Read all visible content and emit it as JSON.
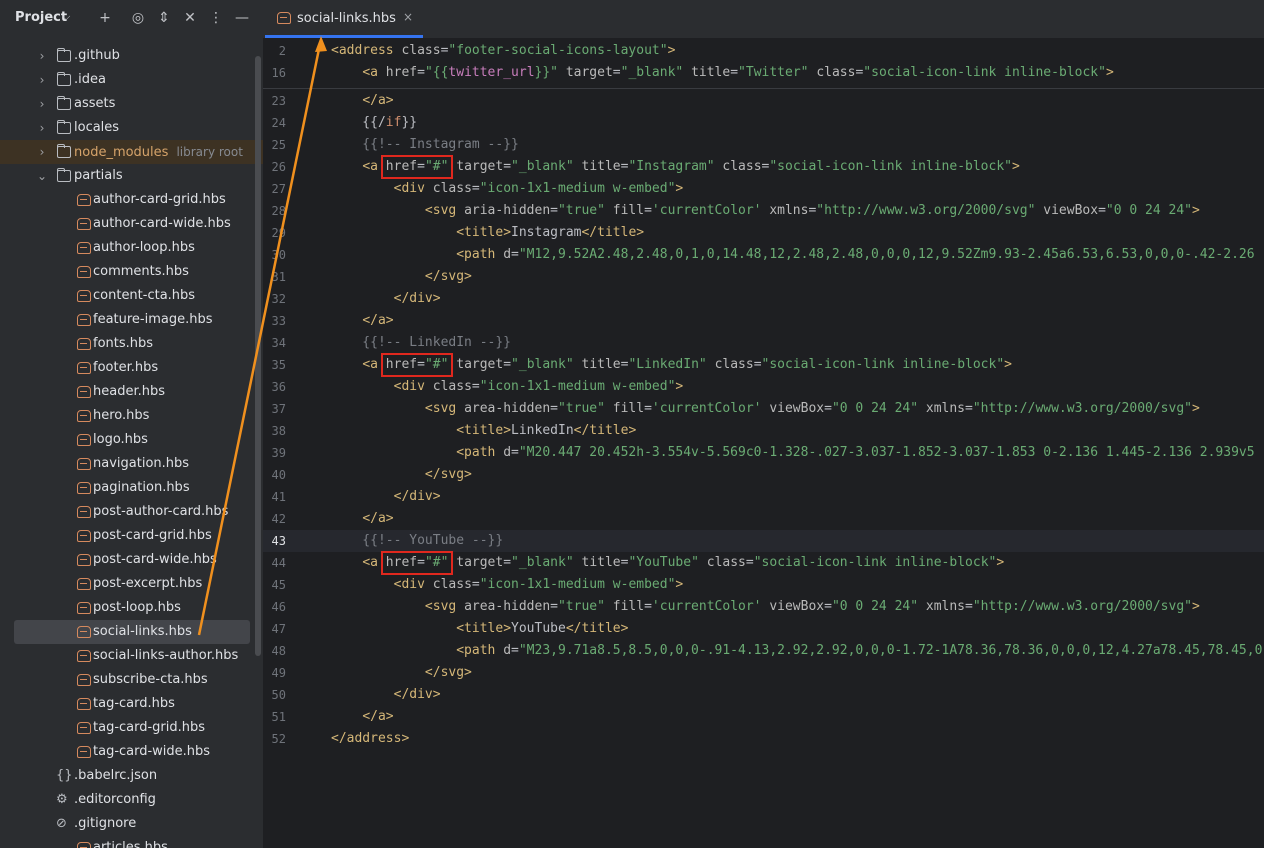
{
  "project": {
    "title": "Project"
  },
  "tree": [
    {
      "label": ".github",
      "kind": "folder"
    },
    {
      "label": ".idea",
      "kind": "folder"
    },
    {
      "label": "assets",
      "kind": "folder"
    },
    {
      "label": "locales",
      "kind": "folder"
    },
    {
      "label": "node_modules",
      "hint": "library root",
      "kind": "folder"
    },
    {
      "label": "partials",
      "kind": "folder-open"
    },
    {
      "label": "author-card-grid.hbs"
    },
    {
      "label": "author-card-wide.hbs"
    },
    {
      "label": "author-loop.hbs"
    },
    {
      "label": "comments.hbs"
    },
    {
      "label": "content-cta.hbs"
    },
    {
      "label": "feature-image.hbs"
    },
    {
      "label": "fonts.hbs"
    },
    {
      "label": "footer.hbs"
    },
    {
      "label": "header.hbs"
    },
    {
      "label": "hero.hbs"
    },
    {
      "label": "logo.hbs"
    },
    {
      "label": "navigation.hbs"
    },
    {
      "label": "pagination.hbs"
    },
    {
      "label": "post-author-card.hbs"
    },
    {
      "label": "post-card-grid.hbs"
    },
    {
      "label": "post-card-wide.hbs"
    },
    {
      "label": "post-excerpt.hbs"
    },
    {
      "label": "post-loop.hbs"
    },
    {
      "label": "social-links.hbs",
      "selected": true
    },
    {
      "label": "social-links-author.hbs"
    },
    {
      "label": "subscribe-cta.hbs"
    },
    {
      "label": "tag-card.hbs"
    },
    {
      "label": "tag-card-grid.hbs"
    },
    {
      "label": "tag-card-wide.hbs"
    },
    {
      "label": ".babelrc.json",
      "kind": "json"
    },
    {
      "label": ".editorconfig",
      "kind": "config"
    },
    {
      "label": ".gitignore",
      "kind": "ignore"
    },
    {
      "label": "articles.hbs"
    }
  ],
  "tab": {
    "label": "social-links.hbs",
    "close": "×"
  },
  "sticky": [
    {
      "num": "2",
      "code": [
        [
          "t",
          "<address "
        ],
        [
          "a",
          "class"
        ],
        [
          "p",
          "="
        ],
        [
          "v",
          "\"footer-social-icons-layout\""
        ],
        [
          "t",
          ">"
        ]
      ]
    },
    {
      "num": "16",
      "code": [
        [
          "p",
          "    "
        ],
        [
          "t",
          "<a "
        ],
        [
          "a",
          "href"
        ],
        [
          "p",
          "="
        ],
        [
          "v",
          "\"{{"
        ],
        [
          "vr",
          "twitter_url"
        ],
        [
          "v",
          "}}\" "
        ],
        [
          "a",
          "target"
        ],
        [
          "p",
          "="
        ],
        [
          "v",
          "\"_blank\" "
        ],
        [
          "a",
          "title"
        ],
        [
          "p",
          "="
        ],
        [
          "v",
          "\"Twitter\" "
        ],
        [
          "a",
          "class"
        ],
        [
          "p",
          "="
        ],
        [
          "v",
          "\"social-icon-link inline-block\""
        ],
        [
          "t",
          ">"
        ]
      ]
    }
  ],
  "lines": [
    {
      "num": "23",
      "code": [
        [
          "p",
          "    "
        ],
        [
          "t",
          "</a>"
        ]
      ]
    },
    {
      "num": "24",
      "code": [
        [
          "p",
          "    {{/"
        ],
        [
          "k",
          "if"
        ],
        [
          "p",
          "}}"
        ]
      ]
    },
    {
      "num": "25",
      "code": [
        [
          "c",
          "    {{!-- Instagram --}}"
        ]
      ]
    },
    {
      "num": "26",
      "code": [
        [
          "p",
          "    "
        ],
        [
          "t",
          "<a "
        ],
        [
          "a",
          "href"
        ],
        [
          "p",
          "="
        ],
        [
          "v",
          "\"#\" "
        ],
        [
          "a",
          "target"
        ],
        [
          "p",
          "="
        ],
        [
          "v",
          "\"_blank\" "
        ],
        [
          "a",
          "title"
        ],
        [
          "p",
          "="
        ],
        [
          "v",
          "\"Instagram\" "
        ],
        [
          "a",
          "class"
        ],
        [
          "p",
          "="
        ],
        [
          "v",
          "\"social-icon-link inline-block\""
        ],
        [
          "t",
          ">"
        ]
      ]
    },
    {
      "num": "27",
      "code": [
        [
          "p",
          "        "
        ],
        [
          "t",
          "<div "
        ],
        [
          "a",
          "class"
        ],
        [
          "p",
          "="
        ],
        [
          "v",
          "\"icon-1x1-medium w-embed\""
        ],
        [
          "t",
          ">"
        ]
      ]
    },
    {
      "num": "28",
      "code": [
        [
          "p",
          "            "
        ],
        [
          "t",
          "<svg "
        ],
        [
          "a",
          "aria-hidden"
        ],
        [
          "p",
          "="
        ],
        [
          "v",
          "\"true\" "
        ],
        [
          "a",
          "fill"
        ],
        [
          "p",
          "="
        ],
        [
          "v",
          "'currentColor' "
        ],
        [
          "a",
          "xmlns"
        ],
        [
          "p",
          "="
        ],
        [
          "v",
          "\"http://www.w3.org/2000/svg\" "
        ],
        [
          "a",
          "viewBox"
        ],
        [
          "p",
          "="
        ],
        [
          "v",
          "\"0 0 24 24\""
        ],
        [
          "t",
          ">"
        ]
      ]
    },
    {
      "num": "29",
      "code": [
        [
          "p",
          "                "
        ],
        [
          "t",
          "<title>"
        ],
        [
          "p",
          "Instagram"
        ],
        [
          "t",
          "</title>"
        ]
      ]
    },
    {
      "num": "30",
      "code": [
        [
          "p",
          "                "
        ],
        [
          "t",
          "<path "
        ],
        [
          "a",
          "d"
        ],
        [
          "p",
          "="
        ],
        [
          "v",
          "\"M12,9.52A2.48,2.48,0,1,0,14.48,12,2.48,2.48,0,0,0,12,9.52Zm9.93-2.45a6.53,6.53,0,0,0-.42-2.26"
        ]
      ]
    },
    {
      "num": "31",
      "code": [
        [
          "p",
          "            "
        ],
        [
          "t",
          "</svg>"
        ]
      ]
    },
    {
      "num": "32",
      "code": [
        [
          "p",
          "        "
        ],
        [
          "t",
          "</div>"
        ]
      ]
    },
    {
      "num": "33",
      "code": [
        [
          "p",
          "    "
        ],
        [
          "t",
          "</a>"
        ]
      ]
    },
    {
      "num": "34",
      "code": [
        [
          "c",
          "    {{!-- LinkedIn --}}"
        ]
      ]
    },
    {
      "num": "35",
      "code": [
        [
          "p",
          "    "
        ],
        [
          "t",
          "<a "
        ],
        [
          "a",
          "href"
        ],
        [
          "p",
          "="
        ],
        [
          "v",
          "\"#\" "
        ],
        [
          "a",
          "target"
        ],
        [
          "p",
          "="
        ],
        [
          "v",
          "\"_blank\" "
        ],
        [
          "a",
          "title"
        ],
        [
          "p",
          "="
        ],
        [
          "v",
          "\"LinkedIn\" "
        ],
        [
          "a",
          "class"
        ],
        [
          "p",
          "="
        ],
        [
          "v",
          "\"social-icon-link inline-block\""
        ],
        [
          "t",
          ">"
        ]
      ]
    },
    {
      "num": "36",
      "code": [
        [
          "p",
          "        "
        ],
        [
          "t",
          "<div "
        ],
        [
          "a",
          "class"
        ],
        [
          "p",
          "="
        ],
        [
          "v",
          "\"icon-1x1-medium w-embed\""
        ],
        [
          "t",
          ">"
        ]
      ]
    },
    {
      "num": "37",
      "code": [
        [
          "p",
          "            "
        ],
        [
          "t",
          "<svg "
        ],
        [
          "a",
          "area-hidden"
        ],
        [
          "p",
          "="
        ],
        [
          "v",
          "\"true\" "
        ],
        [
          "a",
          "fill"
        ],
        [
          "p",
          "="
        ],
        [
          "v",
          "'currentColor' "
        ],
        [
          "a",
          "viewBox"
        ],
        [
          "p",
          "="
        ],
        [
          "v",
          "\"0 0 24 24\" "
        ],
        [
          "a",
          "xmlns"
        ],
        [
          "p",
          "="
        ],
        [
          "v",
          "\"http://www.w3.org/2000/svg\""
        ],
        [
          "t",
          ">"
        ]
      ]
    },
    {
      "num": "38",
      "code": [
        [
          "p",
          "                "
        ],
        [
          "t",
          "<title>"
        ],
        [
          "p",
          "LinkedIn"
        ],
        [
          "t",
          "</title>"
        ]
      ]
    },
    {
      "num": "39",
      "code": [
        [
          "p",
          "                "
        ],
        [
          "t",
          "<path "
        ],
        [
          "a",
          "d"
        ],
        [
          "p",
          "="
        ],
        [
          "v",
          "\"M20.447 20.452h-3.554v-5.569c0-1.328-.027-3.037-1.852-3.037-1.853 0-2.136 1.445-2.136 2.939v5"
        ]
      ]
    },
    {
      "num": "40",
      "code": [
        [
          "p",
          "            "
        ],
        [
          "t",
          "</svg>"
        ]
      ]
    },
    {
      "num": "41",
      "code": [
        [
          "p",
          "        "
        ],
        [
          "t",
          "</div>"
        ]
      ]
    },
    {
      "num": "42",
      "code": [
        [
          "p",
          "    "
        ],
        [
          "t",
          "</a>"
        ]
      ]
    },
    {
      "num": "43",
      "code": [
        [
          "c",
          "    {{!-- YouTube --}}"
        ]
      ],
      "current": true
    },
    {
      "num": "44",
      "code": [
        [
          "p",
          "    "
        ],
        [
          "t",
          "<a "
        ],
        [
          "a",
          "href"
        ],
        [
          "p",
          "="
        ],
        [
          "v",
          "\"#\" "
        ],
        [
          "a",
          "target"
        ],
        [
          "p",
          "="
        ],
        [
          "v",
          "\"_blank\" "
        ],
        [
          "a",
          "title"
        ],
        [
          "p",
          "="
        ],
        [
          "v",
          "\"YouTube\" "
        ],
        [
          "a",
          "class"
        ],
        [
          "p",
          "="
        ],
        [
          "v",
          "\"social-icon-link inline-block\""
        ],
        [
          "t",
          ">"
        ]
      ]
    },
    {
      "num": "45",
      "code": [
        [
          "p",
          "        "
        ],
        [
          "t",
          "<div "
        ],
        [
          "a",
          "class"
        ],
        [
          "p",
          "="
        ],
        [
          "v",
          "\"icon-1x1-medium w-embed\""
        ],
        [
          "t",
          ">"
        ]
      ]
    },
    {
      "num": "46",
      "code": [
        [
          "p",
          "            "
        ],
        [
          "t",
          "<svg "
        ],
        [
          "a",
          "area-hidden"
        ],
        [
          "p",
          "="
        ],
        [
          "v",
          "\"true\" "
        ],
        [
          "a",
          "fill"
        ],
        [
          "p",
          "="
        ],
        [
          "v",
          "'currentColor' "
        ],
        [
          "a",
          "viewBox"
        ],
        [
          "p",
          "="
        ],
        [
          "v",
          "\"0 0 24 24\" "
        ],
        [
          "a",
          "xmlns"
        ],
        [
          "p",
          "="
        ],
        [
          "v",
          "\"http://www.w3.org/2000/svg\""
        ],
        [
          "t",
          ">"
        ]
      ]
    },
    {
      "num": "47",
      "code": [
        [
          "p",
          "                "
        ],
        [
          "t",
          "<title>"
        ],
        [
          "p",
          "YouTube"
        ],
        [
          "t",
          "</title>"
        ]
      ]
    },
    {
      "num": "48",
      "code": [
        [
          "p",
          "                "
        ],
        [
          "t",
          "<path "
        ],
        [
          "a",
          "d"
        ],
        [
          "p",
          "="
        ],
        [
          "v",
          "\"M23,9.71a8.5,8.5,0,0,0-.91-4.13,2.92,2.92,0,0,0-1.72-1A78.36,78.36,0,0,0,12,4.27a78.45,78.45,0"
        ]
      ]
    },
    {
      "num": "49",
      "code": [
        [
          "p",
          "            "
        ],
        [
          "t",
          "</svg>"
        ]
      ]
    },
    {
      "num": "50",
      "code": [
        [
          "p",
          "        "
        ],
        [
          "t",
          "</div>"
        ]
      ]
    },
    {
      "num": "51",
      "code": [
        [
          "p",
          "    "
        ],
        [
          "t",
          "</a>"
        ]
      ]
    },
    {
      "num": "52",
      "code": [
        [
          "t",
          "</address>"
        ]
      ]
    }
  ],
  "colors": {
    "annotation_box": "#e0281e",
    "annotation_arrow": "#f0901e",
    "accent": "#3574f0"
  }
}
